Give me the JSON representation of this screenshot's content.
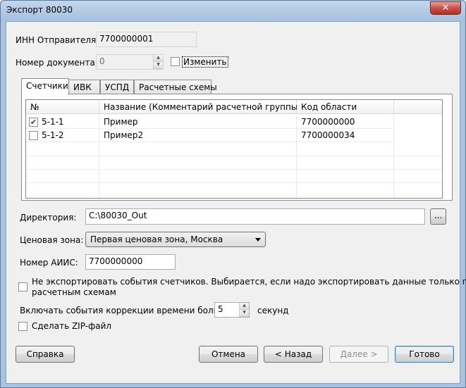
{
  "window": {
    "title": "Экспорт 80030",
    "close_label": "✕"
  },
  "inn": {
    "label": "ИНН Отправителя:",
    "value": "7700000001"
  },
  "doc_number": {
    "label": "Номер документа:",
    "value": "0",
    "change_label": "Изменить",
    "change_checked": false
  },
  "tabs": [
    {
      "label": "Счетчики",
      "active": true
    },
    {
      "label": "ИВК",
      "active": false
    },
    {
      "label": "УСПД",
      "active": false
    },
    {
      "label": "Расчетные схемы",
      "active": false
    }
  ],
  "table": {
    "columns": [
      "№",
      "Название (Комментарий расчетной группы)",
      "Код области"
    ],
    "rows": [
      {
        "num": "5-1-1",
        "name": "Пример",
        "code": "7700000000",
        "checked": true
      },
      {
        "num": "5-1-2",
        "name": "Пример2",
        "code": "7700000034",
        "checked": false
      }
    ]
  },
  "directory": {
    "label": "Директория:",
    "value": "C:\\80030_Out",
    "browse_label": "..."
  },
  "price_zone": {
    "label": "Ценовая зона:",
    "value": "Первая ценовая зона, Москва"
  },
  "aiis": {
    "label": "Номер АИИС:",
    "value": "7700000000"
  },
  "no_export_events": {
    "line1": "Не экспортировать события счетчиков. Выбирается, если надо экспортировать данные только по",
    "line2": "расчетным схемам",
    "checked": false
  },
  "time_correction": {
    "label": "Включать события коррекции времени больше:",
    "value": "5",
    "unit": "секунд"
  },
  "zip": {
    "label": "Сделать ZIP-файл",
    "checked": false
  },
  "buttons": {
    "help": "Справка",
    "cancel": "Отмена",
    "back": "< Назад",
    "next": "Далее >",
    "finish": "Готово"
  }
}
